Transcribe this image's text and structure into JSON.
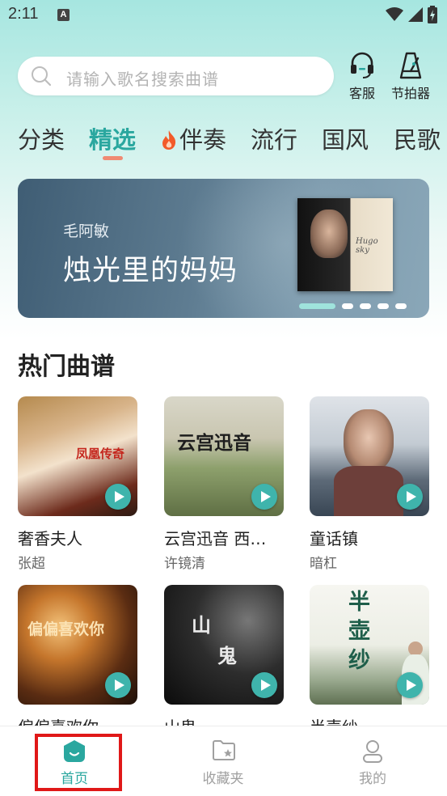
{
  "status_bar": {
    "time": "2:11",
    "notification_letter": "A"
  },
  "search": {
    "placeholder": "请输入歌名搜索曲谱"
  },
  "top_actions": [
    {
      "label": "客服",
      "icon": "headset-icon"
    },
    {
      "label": "节拍器",
      "icon": "metronome-icon"
    }
  ],
  "tabs": [
    {
      "label": "分类",
      "active": false
    },
    {
      "label": "精选",
      "active": true
    },
    {
      "label": "伴奏",
      "active": false,
      "icon": "flame-icon"
    },
    {
      "label": "流行",
      "active": false
    },
    {
      "label": "国风",
      "active": false
    },
    {
      "label": "民歌",
      "active": false
    }
  ],
  "banner": {
    "artist": "毛阿敏",
    "title": "烛光里的妈妈",
    "cover_script": "Hugo sky",
    "slide_count": 5,
    "active_slide": 1
  },
  "section": {
    "title": "热门曲谱"
  },
  "songs": [
    {
      "name": "奢香夫人",
      "artist": "张超",
      "cover_text": "凤凰传奇"
    },
    {
      "name": "云宫迅音 西…",
      "artist": "许镜清",
      "cover_text": "云宫迅音"
    },
    {
      "name": "童话镇",
      "artist": "暗杠",
      "cover_text": ""
    },
    {
      "name": "偏偏喜欢你",
      "artist": "",
      "cover_text": "偏偏喜欢你"
    },
    {
      "name": "山鬼",
      "artist": "",
      "cover_text_1": "山",
      "cover_text_2": "鬼"
    },
    {
      "name": "半壶纱",
      "artist": "",
      "cover_text": "半壶纱"
    }
  ],
  "bottom_nav": [
    {
      "label": "首页",
      "active": true,
      "icon": "home-icon"
    },
    {
      "label": "收藏夹",
      "active": false,
      "icon": "favorites-folder-icon"
    },
    {
      "label": "我的",
      "active": false,
      "icon": "profile-icon"
    }
  ],
  "colors": {
    "accent": "#2aa79f",
    "tab_underline": "#f08a73",
    "highlight": "#e01818"
  }
}
